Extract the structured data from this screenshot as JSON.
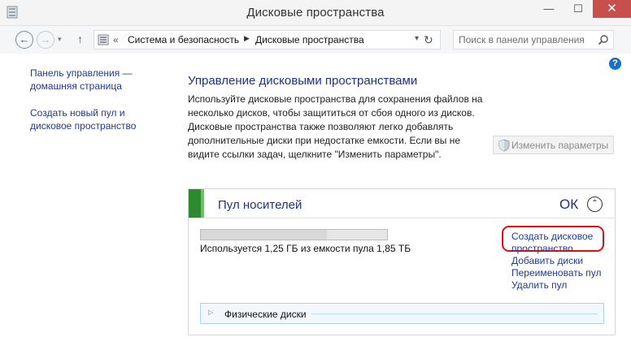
{
  "window": {
    "title": "Дисковые пространства",
    "minimize": "—",
    "maximize": "☐",
    "close": "✕"
  },
  "nav": {
    "back": "←",
    "forward": "→",
    "history_dropdown": "▾",
    "up": "↑",
    "breadcrumb_sep": "«",
    "breadcrumbs": [
      "Система и безопасность",
      "Дисковые пространства"
    ],
    "breadcrumb_arrow": "▶",
    "address_dropdown": "▾",
    "refresh": "↻",
    "search_placeholder": "Поиск в панели управления"
  },
  "help": {
    "label": "?"
  },
  "sidebar": {
    "items": [
      {
        "label": "Панель управления — домашняя страница"
      },
      {
        "label": "Создать новый пул и дисковое пространство"
      }
    ]
  },
  "main": {
    "heading": "Управление дисковыми пространствами",
    "description": "Используйте дисковые пространства для сохранения файлов на несколько дисков, чтобы защититься от сбоя одного из дисков. Дисковые пространства также позволяют легко добавлять дополнительные диски при недостатке емкости. Если вы не видите ссылки задач, щелкните \"Изменить параметры\".",
    "change_settings": "Изменить параметры"
  },
  "pool": {
    "name": "Пул носителей",
    "status": "ОК",
    "collapse_glyph": "⌃",
    "used_fraction": 0.676,
    "usage_text": "Используется 1,25 ГБ из емкости пула 1,85 ТБ",
    "tasks": [
      "Создать дисковое пространство",
      "Добавить диски",
      "Переименовать пул",
      "Удалить пул"
    ],
    "physical_disks_label": "Физические диски",
    "physical_disks_glyph": "▷"
  },
  "colors": {
    "accent_link": "#1f3a93",
    "status_green": "#2d8a31",
    "highlight_red": "#e01010",
    "close_button": "#c7504f"
  }
}
